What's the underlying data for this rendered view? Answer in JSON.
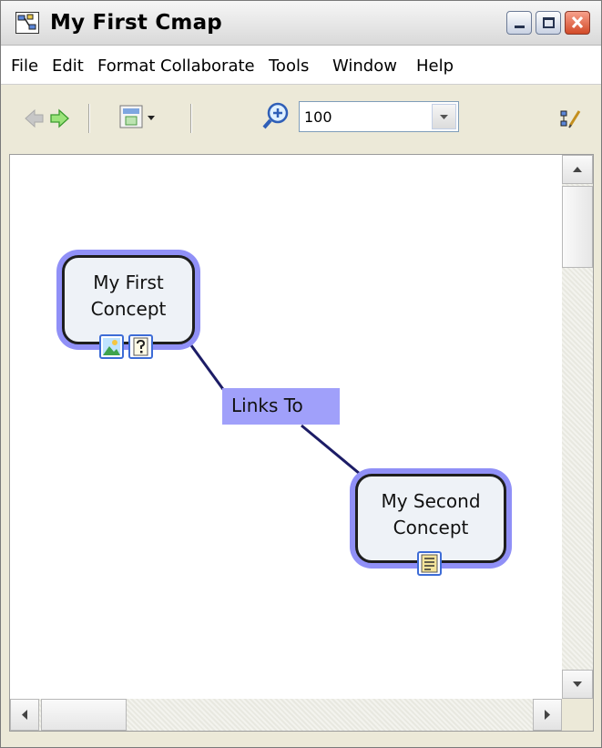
{
  "window": {
    "title": "My First Cmap"
  },
  "menu": [
    "File",
    "Edit",
    "Format",
    "Collaborate",
    "Tools",
    "Window",
    "Help"
  ],
  "toolbar": {
    "zoom_value": "100"
  },
  "concepts": [
    {
      "line1": "My First",
      "line2": "Concept",
      "resources": [
        "image-resource-icon",
        "help-resource-icon"
      ]
    },
    {
      "line1": "My Second",
      "line2": "Concept",
      "resources": [
        "text-resource-icon"
      ]
    }
  ],
  "link": {
    "label": "Links To",
    "color": "#1c1c66"
  },
  "colors": {
    "concept_halo": "#9090f7",
    "concept_fill": "#eef2f7",
    "link_label_bg": "#a0a0fa"
  }
}
